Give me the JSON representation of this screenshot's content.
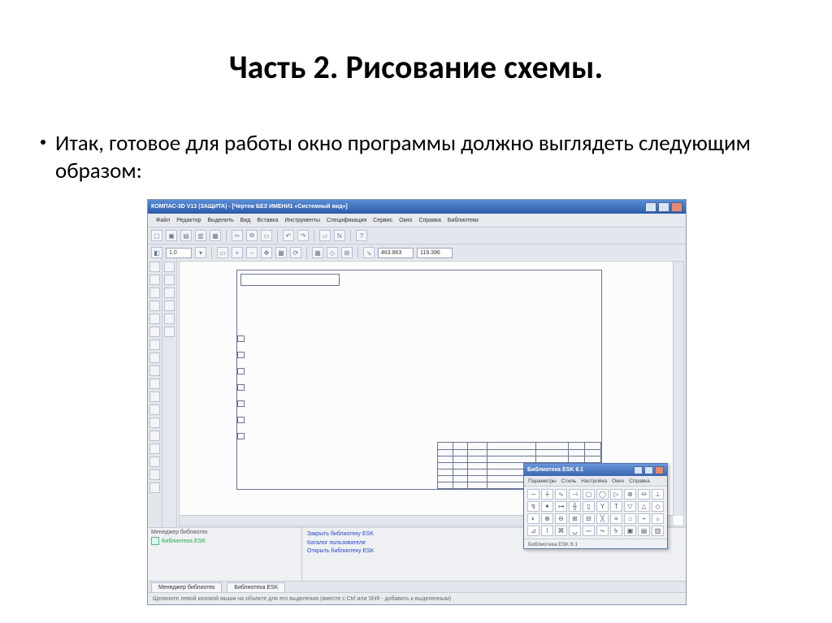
{
  "title": "Часть 2. Рисование схемы.",
  "bullet": "Итак, готовое для работы окно программы должно выглядеть следующим образом:",
  "app": {
    "titlebar": "КОМПАС-3D V13 (ЗАЩИТА) - [Чертеж БЕЗ ИМЕНИ1   «Системный вид»]",
    "menus": [
      "Файл",
      "Редактор",
      "Выделить",
      "Вид",
      "Вставка",
      "Инструменты",
      "Спецификация",
      "Сервис",
      "Окно",
      "Справка",
      "Библиотеки"
    ],
    "row2": {
      "scale": "1.0",
      "x": "463.863",
      "y": "119.396"
    },
    "libmgr": {
      "header": "Менеджер библиотек",
      "item": "Библиотека ESK",
      "actions": [
        "Закрыть библиотеку ESK",
        "Каталог пользователя",
        "Открыть библиотеку ESK"
      ]
    },
    "tabs": [
      "Менеджер библиотек",
      "Библиотека ESK"
    ],
    "statusbar": "Щелкните левой кнопкой мыши на объекте для его выделения (вместе с Ctrl или Shift - добавить к выделенным)",
    "palette": {
      "title": "Библиотека ESK 6.1",
      "menus": [
        "Параметры",
        "Стиль",
        "Настройка",
        "Окно",
        "Справка"
      ],
      "status": "Библиотека ESK 6.1"
    }
  }
}
